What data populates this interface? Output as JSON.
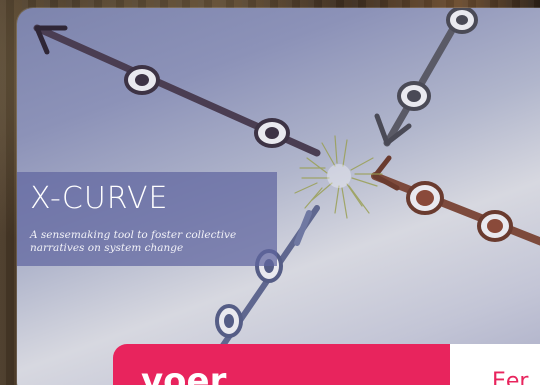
{
  "image": {
    "title": "X-CURVE",
    "subtitle": "A sensemaking tool to foster collective narratives on system change",
    "icon": "x-curve-arrows-illustration"
  },
  "banner": {
    "brand": "voer",
    "partial_text": "Eer",
    "accent_color": "#e8245d"
  }
}
